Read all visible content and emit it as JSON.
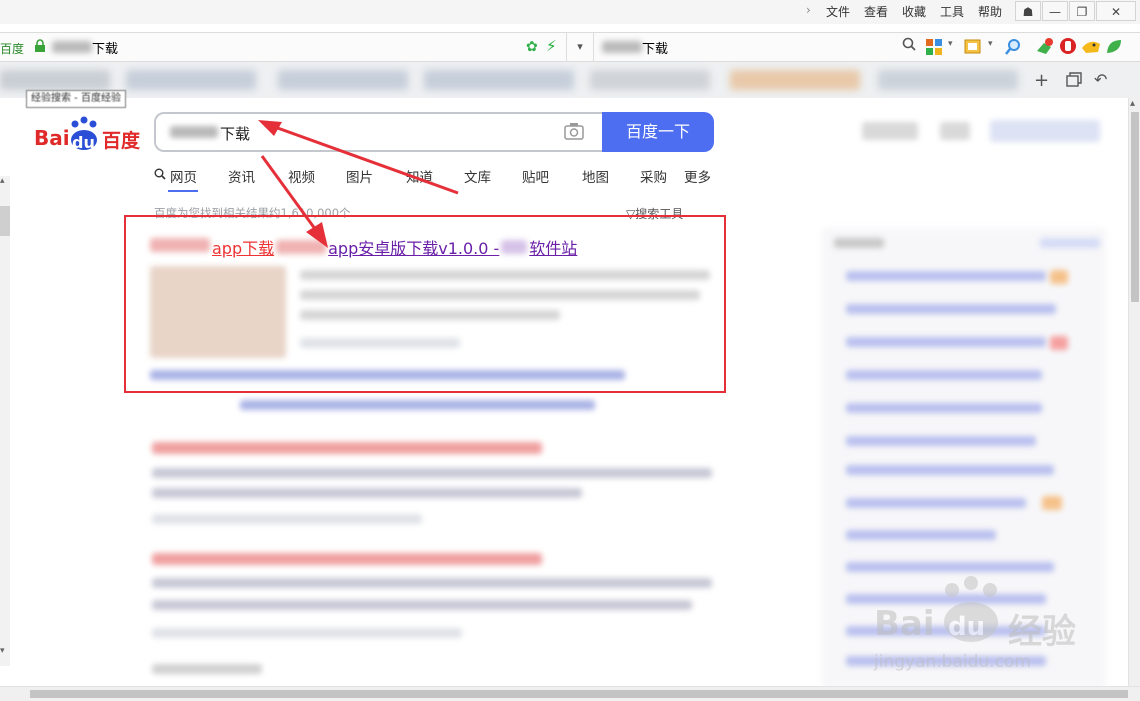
{
  "menubar": {
    "items": [
      "文件",
      "查看",
      "收藏",
      "工具",
      "帮助"
    ],
    "window_buttons": [
      "☗",
      "—",
      "❐",
      "✕"
    ]
  },
  "address": {
    "site_label": "百度",
    "url_suffix": "下载",
    "search_suffix": "下载"
  },
  "tooltip": "经验搜索 - 百度经验",
  "baidu": {
    "logo_text_left": "Bai",
    "logo_text_du": "du",
    "logo_text_cn": "百度",
    "search_value": "下载",
    "search_button": "百度一下",
    "tabs": [
      "网页",
      "资讯",
      "视频",
      "图片",
      "知道",
      "文库",
      "贴吧",
      "地图",
      "采购",
      "更多"
    ],
    "result_count": "百度为您找到相关结果约1,610,000个",
    "search_tools": "搜索工具",
    "first_result": {
      "red1": "app下载",
      "purple1": "app安卓版下载v1.0.0 -",
      "purple2": "软件站"
    }
  },
  "watermark": {
    "brand_latin": "Bai",
    "brand_du": "du",
    "brand_cn": "经验",
    "url": "jingyan.baidu.com"
  }
}
